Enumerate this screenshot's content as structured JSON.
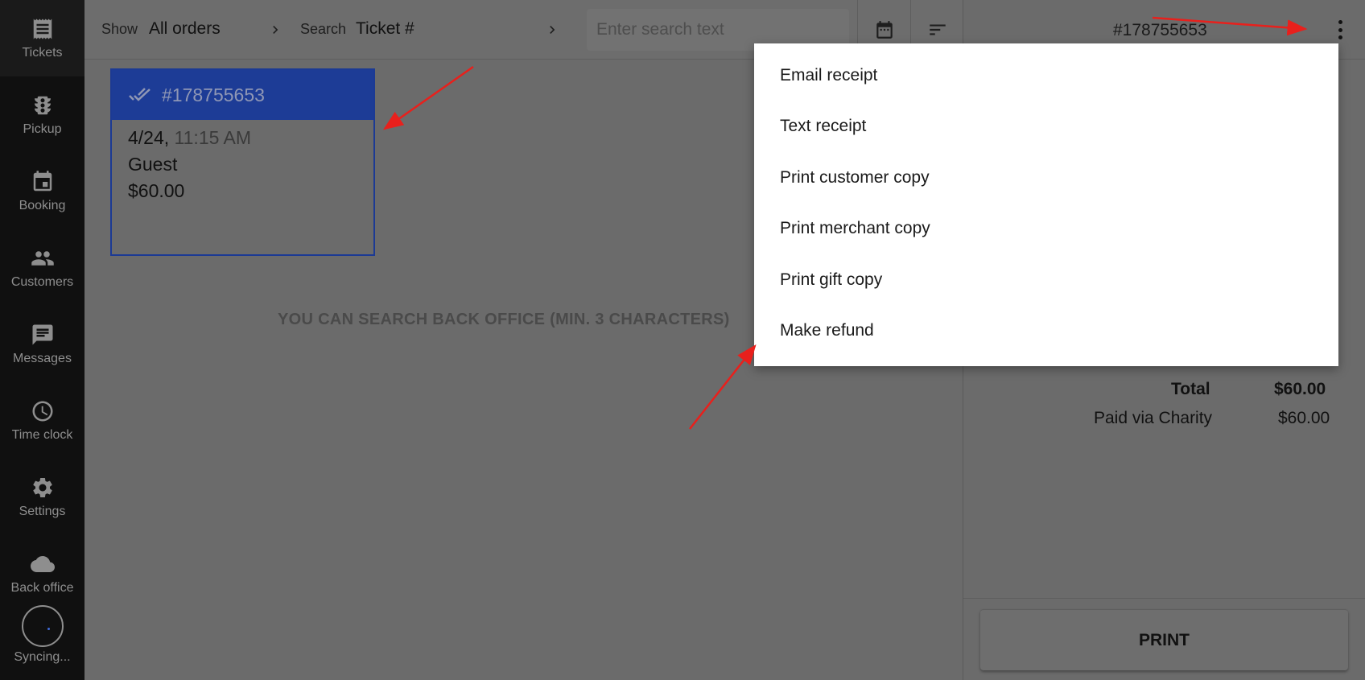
{
  "sidebar": {
    "items": [
      {
        "label": "Tickets",
        "icon": "receipt-icon"
      },
      {
        "label": "Pickup",
        "icon": "traffic-light-icon"
      },
      {
        "label": "Booking",
        "icon": "calendar-event-icon"
      },
      {
        "label": "Customers",
        "icon": "people-icon"
      },
      {
        "label": "Messages",
        "icon": "message-icon"
      },
      {
        "label": "Time clock",
        "icon": "clock-icon"
      },
      {
        "label": "Settings",
        "icon": "gear-icon"
      },
      {
        "label": "Back office",
        "icon": "cloud-icon"
      }
    ],
    "sync_label": "Syncing..."
  },
  "toolbar": {
    "show_label": "Show",
    "show_value": "All orders",
    "search_label": "Search",
    "search_value": "Ticket #",
    "search_placeholder": "Enter search text"
  },
  "ticket_card": {
    "number": "#178755653",
    "date": "4/24,",
    "time": "11:15 AM",
    "customer": "Guest",
    "amount": "$60.00"
  },
  "hint": "YOU CAN SEARCH BACK OFFICE (MIN. 3 CHARACTERS)",
  "detail": {
    "title": "#178755653",
    "total_label": "Total",
    "total_value": "$60.00",
    "paid_label": "Paid via Charity",
    "paid_value": "$60.00",
    "print_label": "PRINT"
  },
  "menu": {
    "items": [
      "Email receipt",
      "Text receipt",
      "Print customer copy",
      "Print merchant copy",
      "Print gift copy",
      "Make refund"
    ]
  },
  "colors": {
    "accent": "#1d3c96",
    "annotation": "#e8201c"
  }
}
